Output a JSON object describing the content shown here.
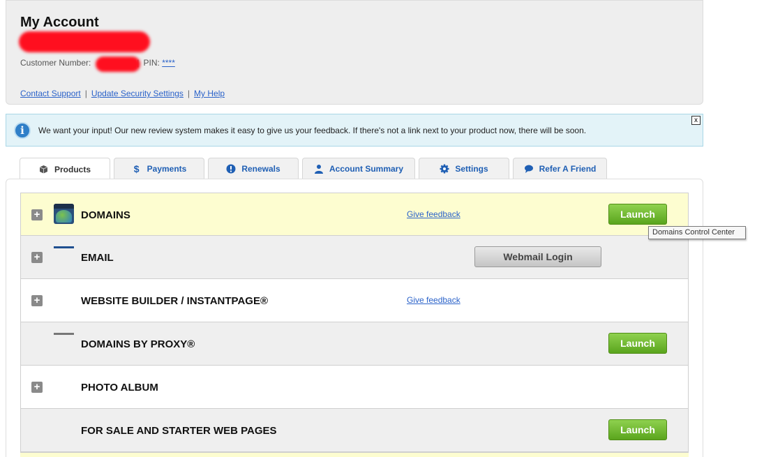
{
  "account": {
    "title": "My Account",
    "customer_number_label": "Customer Number:",
    "pin_label": "PIN:",
    "pin_value": "****",
    "links": [
      "Contact Support",
      "Update Security Settings",
      "My Help"
    ]
  },
  "banner": {
    "text": "We want your input! Our new review system makes it easy to give us your feedback. If there's not a link next to your product now, there will be soon.",
    "close_label": "x"
  },
  "tabs": [
    {
      "label": "Products",
      "icon": "box-icon"
    },
    {
      "label": "Payments",
      "icon": "dollar-icon"
    },
    {
      "label": "Renewals",
      "icon": "alert-icon"
    },
    {
      "label": "Account Summary",
      "icon": "person-icon"
    },
    {
      "label": "Settings",
      "icon": "gear-icon"
    },
    {
      "label": "Refer A Friend",
      "icon": "speech-bubble-icon"
    }
  ],
  "products": [
    {
      "title": "DOMAINS",
      "feedback": "Give feedback",
      "button": "Launch"
    },
    {
      "title": "EMAIL",
      "button": "Webmail Login"
    },
    {
      "title": "WEBSITE BUILDER / INSTANTPAGE®",
      "feedback": "Give feedback"
    },
    {
      "title": "DOMAINS BY PROXY®",
      "button": "Launch"
    },
    {
      "title": "PHOTO ALBUM"
    },
    {
      "title": "FOR SALE AND STARTER WEB PAGES",
      "button": "Launch"
    }
  ],
  "tooltip": "Domains Control Center",
  "colors": {
    "link": "#2a62c9",
    "launch_green": "#6bb52a",
    "info_bg": "#e3f3f8",
    "highlight_row": "#fdfdd0"
  }
}
